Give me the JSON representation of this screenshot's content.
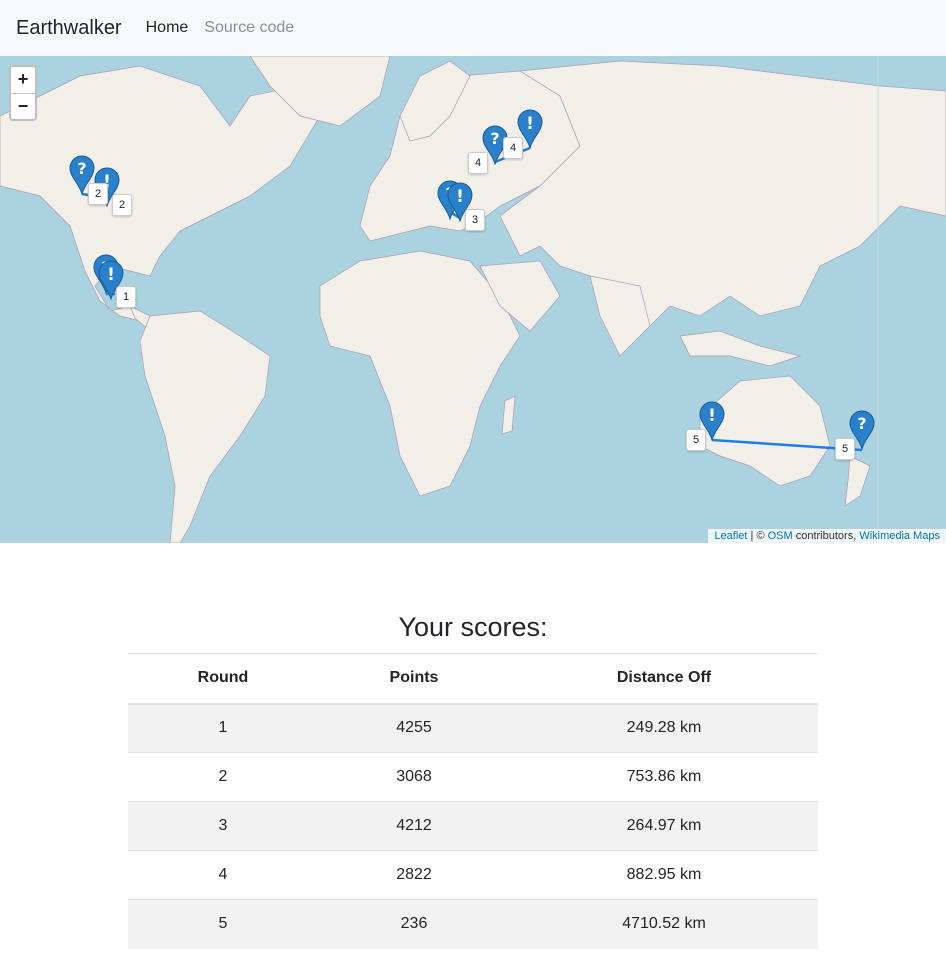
{
  "navbar": {
    "brand": "Earthwalker",
    "links": [
      {
        "label": "Home",
        "active": true
      },
      {
        "label": "Source code",
        "active": false
      }
    ]
  },
  "map": {
    "zoom_in": "+",
    "zoom_out": "−",
    "attribution": {
      "leaflet": "Leaflet",
      "separator": " | © ",
      "osm": "OSM",
      "contributors": " contributors, ",
      "wikimedia": "Wikimedia Maps"
    },
    "colors": {
      "water": "#aad3df",
      "land": "#f2efe9",
      "line": "#1e7fe0",
      "marker": "#2a81cb"
    },
    "round_labels": [
      "1",
      "2",
      "3",
      "4",
      "5"
    ]
  },
  "scores": {
    "title": "Your scores:",
    "headers": [
      "Round",
      "Points",
      "Distance Off"
    ],
    "rows": [
      [
        "1",
        "4255",
        "249.28 km"
      ],
      [
        "2",
        "3068",
        "753.86 km"
      ],
      [
        "3",
        "4212",
        "264.97 km"
      ],
      [
        "4",
        "2822",
        "882.95 km"
      ],
      [
        "5",
        "236",
        "4710.52 km"
      ]
    ]
  }
}
